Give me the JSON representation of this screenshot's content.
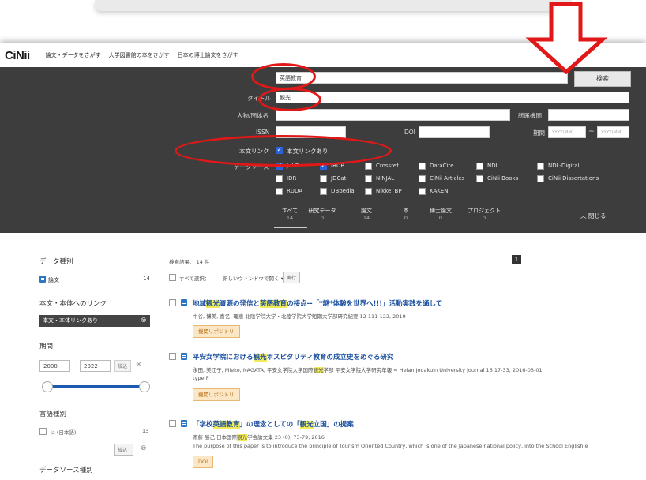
{
  "nav": {
    "logo": "CiNii",
    "links": [
      "論文・データをさがす",
      "大学図書館の本をさがす",
      "日本の博士論文をさがす"
    ]
  },
  "search": {
    "freeword_value": "英語教育",
    "button_label": "検索",
    "title_label": "タイトル",
    "title_value": "観光",
    "person_label": "人物/団体名",
    "institution_label": "所属機関",
    "issn_label": "ISSN",
    "doi_label": "DOI",
    "period_label": "期間",
    "period_from_placeholder": "YYYY(MM)",
    "period_tilde": "~",
    "period_to_placeholder": "YYYY(MM)",
    "fulltext_label": "本文リンク",
    "fulltext_option": "本文リンクあり",
    "datasource_label": "データソース",
    "sources": [
      "JaLC",
      "IRDB",
      "Crossref",
      "DataCite",
      "NDL",
      "NDL-Digital",
      "IDR",
      "JDCat",
      "NINJAL",
      "CiNii Articles",
      "CiNii Books",
      "CiNii Dissertations",
      "RUDA",
      "DBpedia",
      "Nikkei BP",
      "KAKEN"
    ]
  },
  "tabs": [
    {
      "label": "すべて",
      "count": "14"
    },
    {
      "label": "研究データ",
      "count": "0"
    },
    {
      "label": "論文",
      "count": "14"
    },
    {
      "label": "本",
      "count": "0"
    },
    {
      "label": "博士論文",
      "count": "0"
    },
    {
      "label": "プロジェクト",
      "count": "0"
    }
  ],
  "close_label": "閉じる",
  "sidebar": {
    "data_type_heading": "データ種別",
    "data_type_item": "論文",
    "data_type_count": "14",
    "fulltext_heading": "本文・本体へのリンク",
    "fulltext_selected": "本文・本体リンクあり",
    "period_heading": "期間",
    "period_from": "2000",
    "period_tilde": "~",
    "period_to": "2022",
    "period_button": "絞込",
    "language_heading": "言語種別",
    "language_item": "ja (日本語)",
    "language_count": "13",
    "language_button": "絞込",
    "source_heading": "データソース種別"
  },
  "results_bar": {
    "count_text": "検索結果： 14 件",
    "select_all": "すべて選択：",
    "action_select": "新しいウィンドウで開く ▾",
    "run_button": "実行",
    "page": "1"
  },
  "results": [
    {
      "title_parts": [
        "地域",
        "観光",
        "資源の発信と",
        "英語教育",
        "の接点--「*謎*体験を世界へ!!!」活動実践を通して"
      ],
      "meta": "中谷, 博美, 喜名, 理恵  北陸学院大学・北陸学院大学短期大学部研究紀要 12 111-122, 2019",
      "extra": "",
      "button": "機関リポジトリ"
    },
    {
      "title_parts": [
        "平安女学院における",
        "観光",
        "ホスピタリティ教育の成立史をめぐる研究"
      ],
      "meta_parts": [
        "永田, 美江子, Mieko, NAGATA, 平安女学院大学国際",
        "観光",
        "学部 平安女学院大学研究年報 = Heian Jogakuin University journal 16 17-33, 2016-03-01"
      ],
      "extra": "type:P",
      "button": "機関リポジトリ"
    },
    {
      "title_parts": [
        "「学校",
        "英語教育",
        "」の理念としての「",
        "観光",
        "立国」の提案"
      ],
      "meta_parts": [
        "斎藤 勝己 日本国際",
        "観光",
        "学会論文集 23 (0), 73-79, 2016"
      ],
      "extra": "The purpose of this paper is to introduce the principle of Tourism Oriented Country, which is one of the Japanese national policy, into the School English e",
      "button": "DOI"
    }
  ],
  "colors": {
    "panel": "#3d3d3d",
    "accent_red": "#e21818",
    "highlight": "#f3ec5a",
    "link_blue": "#1a4fa0",
    "checkbox_blue": "#2b62d8"
  }
}
